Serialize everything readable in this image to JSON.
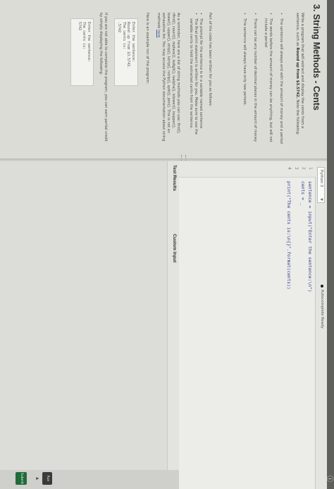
{
  "title": "3. String Methods - Cents",
  "description": {
    "intro": "Write a program that will extract and display the cents from a sentence, such as",
    "example_sentence": "Round up from $3.5742.",
    "note": "Note the following:"
  },
  "notes": [
    "The sentence will always end with the amount of money and a period",
    "The words before the amount of money can be anything, but will not include a period",
    "There can be any number of decimal places in the amount of money",
    "This sentence will always have only two periods."
  ],
  "written_intro": "Part of the code has been written for you as follows:",
  "written_items": [
    "The prompt for the sentence is in a variable named sentence",
    "The final print statement is written for you. Make sure to use the variable cents to hold the extracted cents from the sentence."
  ],
  "reminder": {
    "text": "As a reminder, here are a list of string methods you can use: find(), rfind(), count(), replace(), isdigit(), isalpha(), islower(), isupper(), lower(), upper(), strip(), lstrip(), rstrip(), split(), join(). This is not an exhaustive list. You may access the Python documentation about string methods",
    "link": "here"
  },
  "sample_intro": "Here is an example run of the program:",
  "sample_run": [
    "Enter the sentence:",
    "Round up from $3.5742.",
    "The cents is:",
    ".5742"
  ],
  "partial_credit": "If you are not able to complete the program, you can earn partial credit by simply displaying the following:",
  "partial_run": [
    "Enter the sentence:",
    "The cents is:",
    "5742"
  ],
  "editor": {
    "language": "Python 3",
    "autosave": "Autocomplete Ready",
    "line_numbers": [
      "1",
      "2",
      "3",
      "4"
    ],
    "lines": [
      "sentence = input(\"Enter the sentence:\\n\")",
      "cents = _",
      "",
      "print(\"The cents is:\\n{}\".format(cents))"
    ]
  },
  "tabs": [
    "Test Results",
    "Custom Input"
  ],
  "buttons": {
    "run": "Run",
    "submit": "Submit"
  },
  "icons": {
    "corner": "info-icon",
    "dropdown": "chevron-down-icon",
    "status": "status-dot-icon"
  }
}
